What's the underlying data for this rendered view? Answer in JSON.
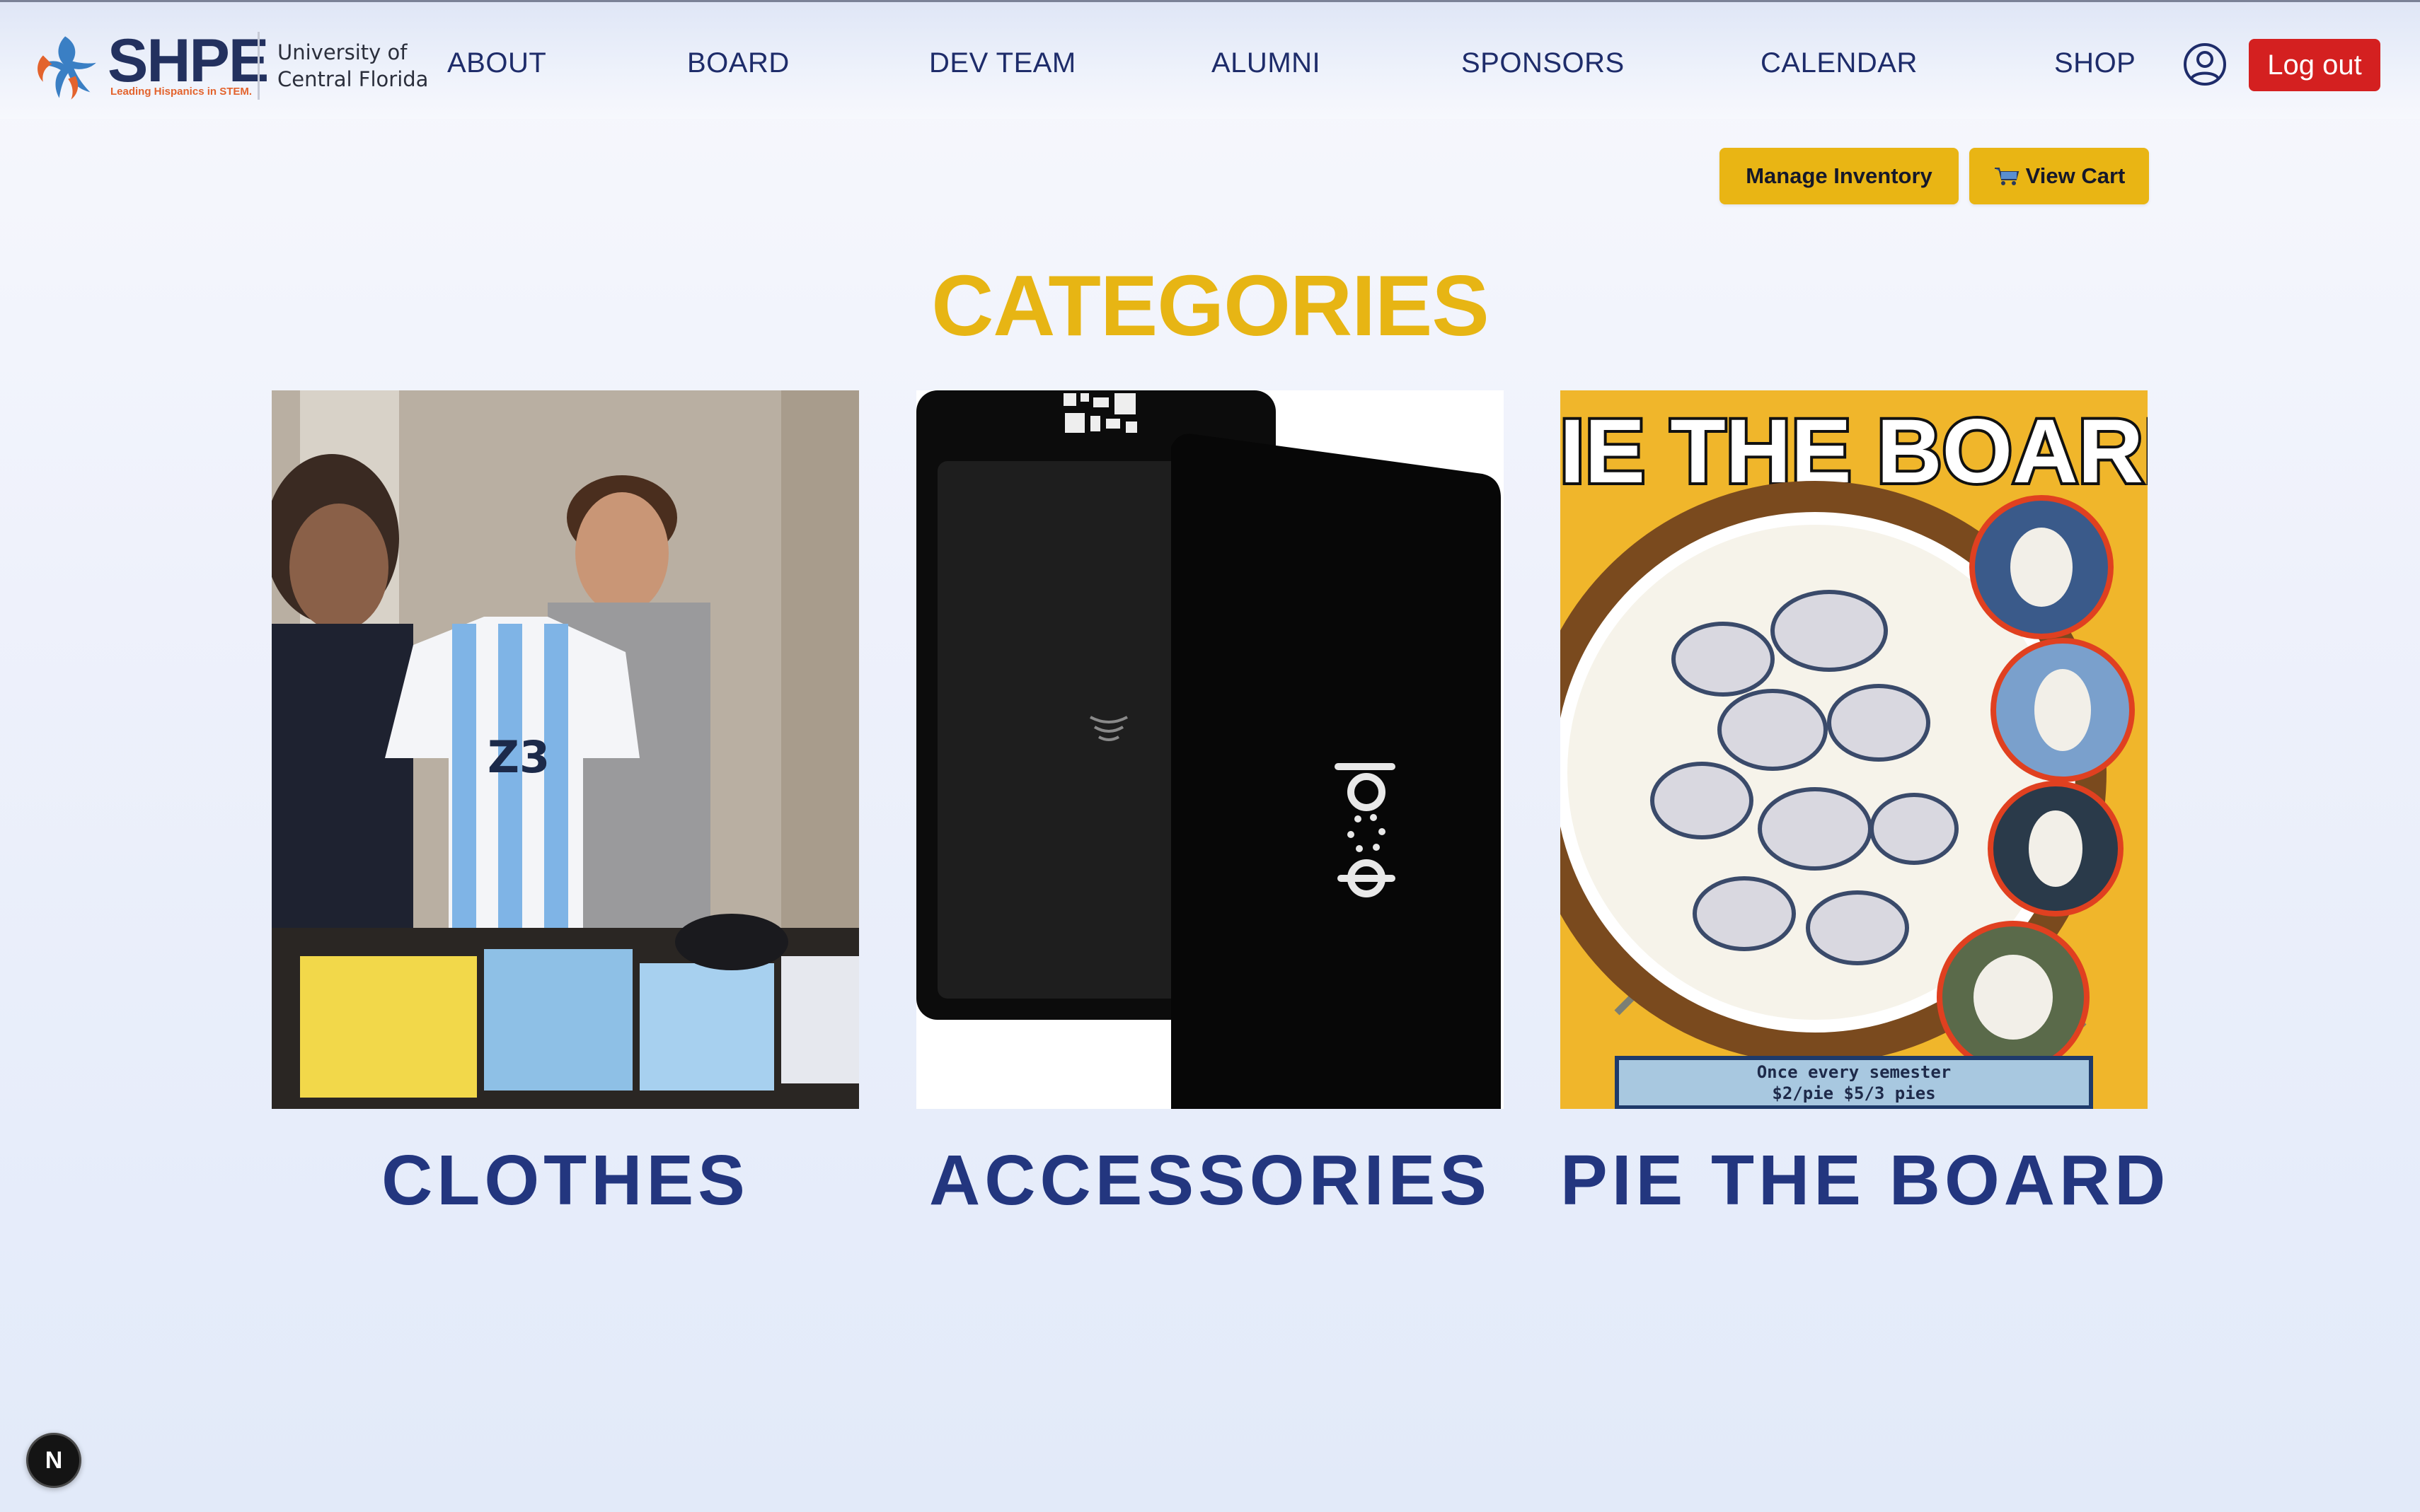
{
  "brand": {
    "name": "SHPE",
    "tagline": "Leading Hispanics in STEM.",
    "school_line1": "University of",
    "school_line2": "Central Florida"
  },
  "nav": {
    "items": [
      {
        "label": "ABOUT"
      },
      {
        "label": "BOARD"
      },
      {
        "label": "DEV TEAM"
      },
      {
        "label": "ALUMNI"
      },
      {
        "label": "SPONSORS"
      },
      {
        "label": "CALENDAR"
      },
      {
        "label": "SHOP"
      }
    ],
    "user_icon": "user-circle-icon",
    "logout_label": "Log out"
  },
  "actions": {
    "manage_inventory_label": "Manage Inventory",
    "view_cart_label": "View Cart",
    "cart_icon": "shopping-cart-icon"
  },
  "main": {
    "title": "CATEGORIES",
    "categories": [
      {
        "label": "CLOTHES"
      },
      {
        "label": "ACCESSORIES"
      },
      {
        "label": "PIE THE BOARD",
        "poster_title": "PIE THE BOARD",
        "poster_caption_1": "Once every semester",
        "poster_caption_2": "$2/pie   $5/3 pies",
        "card_brand": "popl"
      }
    ]
  },
  "colors": {
    "accent_yellow": "#e7b514",
    "brand_navy": "#23367f",
    "logout_red": "#d42020"
  },
  "dev_badge": "N"
}
